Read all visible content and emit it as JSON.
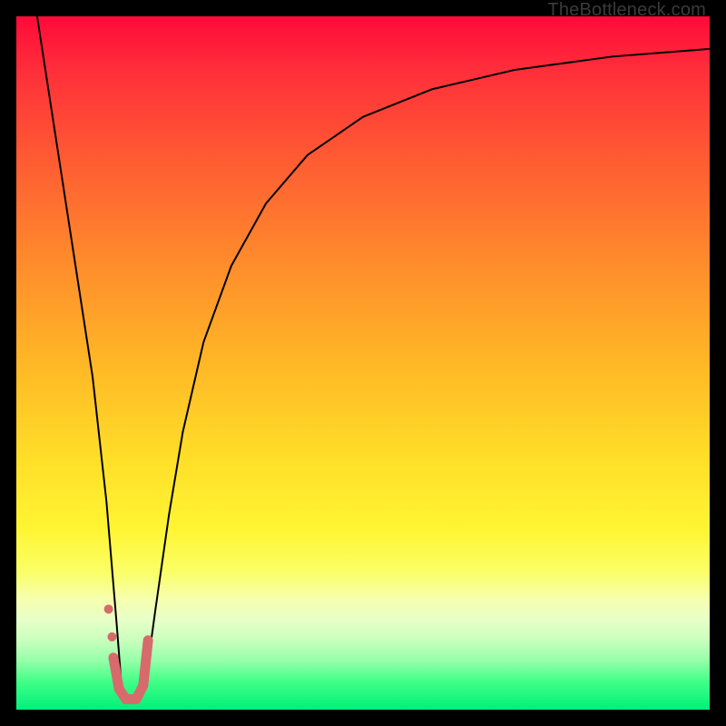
{
  "watermark": "TheBottleneck.com",
  "chart_data": {
    "type": "line",
    "title": "",
    "xlabel": "",
    "ylabel": "",
    "xlim": [
      0,
      100
    ],
    "ylim": [
      0,
      100
    ],
    "grid": false,
    "legend": false,
    "series": [
      {
        "name": "black-curve-left",
        "stroke": "#000000",
        "stroke_width": 2,
        "x": [
          3,
          5,
          7,
          9,
          11,
          13,
          14.5,
          15.2
        ],
        "y": [
          100,
          87,
          74,
          61,
          48,
          30,
          12,
          3
        ]
      },
      {
        "name": "black-curve-right",
        "stroke": "#000000",
        "stroke_width": 2,
        "x": [
          18.5,
          20,
          22,
          24,
          27,
          31,
          36,
          42,
          50,
          60,
          72,
          86,
          100
        ],
        "y": [
          3,
          14,
          28,
          40,
          53,
          64,
          73,
          80,
          85.5,
          89.5,
          92.3,
          94.2,
          95.3
        ]
      },
      {
        "name": "marker-valley",
        "stroke": "#d76a6a",
        "stroke_width": 11,
        "linecap": "round",
        "x": [
          14.0,
          14.8,
          15.8,
          17.3,
          18.3,
          19.0
        ],
        "y": [
          7.5,
          3.0,
          1.5,
          1.5,
          3.5,
          10.0
        ]
      },
      {
        "name": "marker-dots",
        "type": "scatter",
        "fill": "#d76a6a",
        "r": 5,
        "x": [
          13.3,
          13.8
        ],
        "y": [
          14.5,
          10.5
        ]
      }
    ]
  }
}
